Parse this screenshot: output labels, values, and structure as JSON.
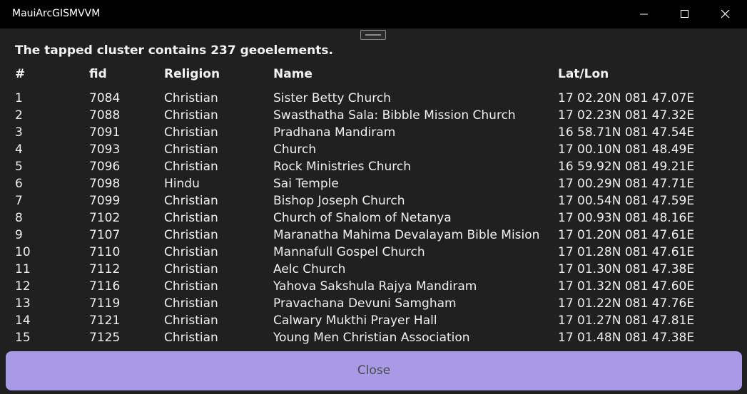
{
  "window": {
    "title": "MauiArcGISMVVM"
  },
  "dialog": {
    "summary": "The tapped cluster contains 237 geoelements.",
    "columns": [
      "#",
      "fid",
      "Religion",
      "Name",
      "Lat/Lon"
    ],
    "rows": [
      [
        "1",
        "7084",
        "Christian",
        "Sister Betty Church",
        "17 02.20N 081 47.07E"
      ],
      [
        "2",
        "7088",
        "Christian",
        "Swasthatha Sala: Bibble Mission Church",
        "17 02.23N 081 47.32E"
      ],
      [
        "3",
        "7091",
        "Christian",
        "Pradhana Mandiram",
        "16 58.71N 081 47.54E"
      ],
      [
        "4",
        "7093",
        "Christian",
        "Church",
        "17 00.10N 081 48.49E"
      ],
      [
        "5",
        "7096",
        "Christian",
        "Rock Ministries Church",
        "16 59.92N 081 49.21E"
      ],
      [
        "6",
        "7098",
        "Hindu",
        "Sai Temple",
        "17 00.29N 081 47.71E"
      ],
      [
        "7",
        "7099",
        "Christian",
        "Bishop Joseph Church",
        "17 00.54N 081 47.59E"
      ],
      [
        "8",
        "7102",
        "Christian",
        "Church of Shalom of Netanya",
        "17 00.93N 081 48.16E"
      ],
      [
        "9",
        "7107",
        "Christian",
        "Maranatha Mahima Devalayam Bible Mision",
        "17 01.20N 081 47.61E"
      ],
      [
        "10",
        "7110",
        "Christian",
        "Mannafull Gospel Church",
        "17 01.28N 081 47.61E"
      ],
      [
        "11",
        "7112",
        "Christian",
        "Aelc Church",
        "17 01.30N 081 47.38E"
      ],
      [
        "12",
        "7116",
        "Christian",
        "Yahova Sakshula Rajya Mandiram",
        "17 01.32N 081 47.60E"
      ],
      [
        "13",
        "7119",
        "Christian",
        "Pravachana Devuni Samgham",
        "17 01.22N 081 47.76E"
      ],
      [
        "14",
        "7121",
        "Christian",
        "Calwary Mukthi Prayer Hall",
        "17 01.27N 081 47.81E"
      ],
      [
        "15",
        "7125",
        "Christian",
        "Young Men Christian Association",
        "17 01.48N 081 47.38E"
      ]
    ],
    "close_label": "Close"
  },
  "colors": {
    "titlebar": "#000000",
    "background": "#202020",
    "close_button": "#a89ae6",
    "text": "#f0f0f0"
  },
  "icons": {
    "minimize": "minimize-icon",
    "maximize": "maximize-icon",
    "close": "close-icon",
    "drag_handle": "drag-handle-icon"
  }
}
